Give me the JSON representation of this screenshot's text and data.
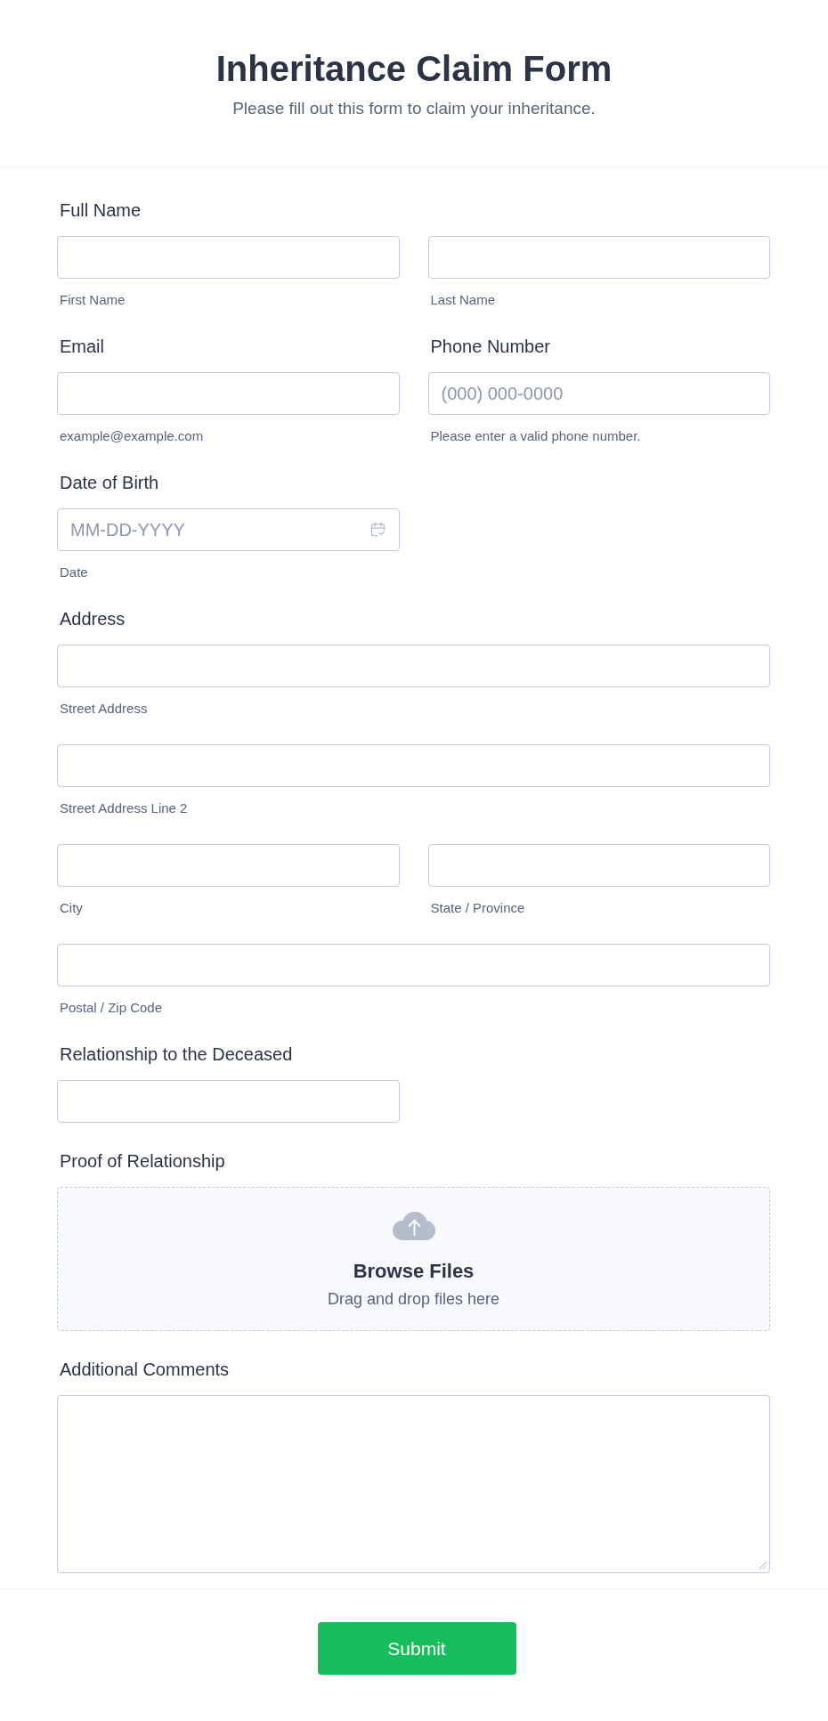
{
  "header": {
    "title": "Inheritance Claim Form",
    "subtitle": "Please fill out this form to claim your inheritance."
  },
  "questions": [
    {
      "kind": "name",
      "label": "Full Name",
      "rows": [
        [
          {
            "sublabel": "First Name"
          },
          {
            "sublabel": "Last Name"
          }
        ]
      ]
    },
    {
      "kind": "email",
      "label": "Email",
      "sublabel": "example@example.com"
    },
    {
      "kind": "phone",
      "label": "Phone Number",
      "placeholder": "(000) 000-0000",
      "sublabel": "Please enter a valid phone number."
    },
    {
      "kind": "date",
      "label": "Date of Birth",
      "placeholder": "MM-DD-YYYY",
      "sublabel": "Date"
    },
    {
      "kind": "address",
      "label": "Address",
      "rows": [
        [
          {
            "sublabel": "Street Address"
          }
        ],
        [
          {
            "sublabel": "Street Address Line 2"
          }
        ],
        [
          {
            "sublabel": "City"
          },
          {
            "sublabel": "State / Province"
          }
        ],
        [
          {
            "sublabel": "Postal / Zip Code"
          }
        ]
      ]
    },
    {
      "kind": "text",
      "label": "Relationship to the Deceased"
    },
    {
      "kind": "upload",
      "label": "Proof of Relationship",
      "button": "Browse Files",
      "hint": "Drag and drop files here"
    },
    {
      "kind": "textarea",
      "label": "Additional Comments"
    }
  ],
  "footer": {
    "submit": "Submit"
  }
}
